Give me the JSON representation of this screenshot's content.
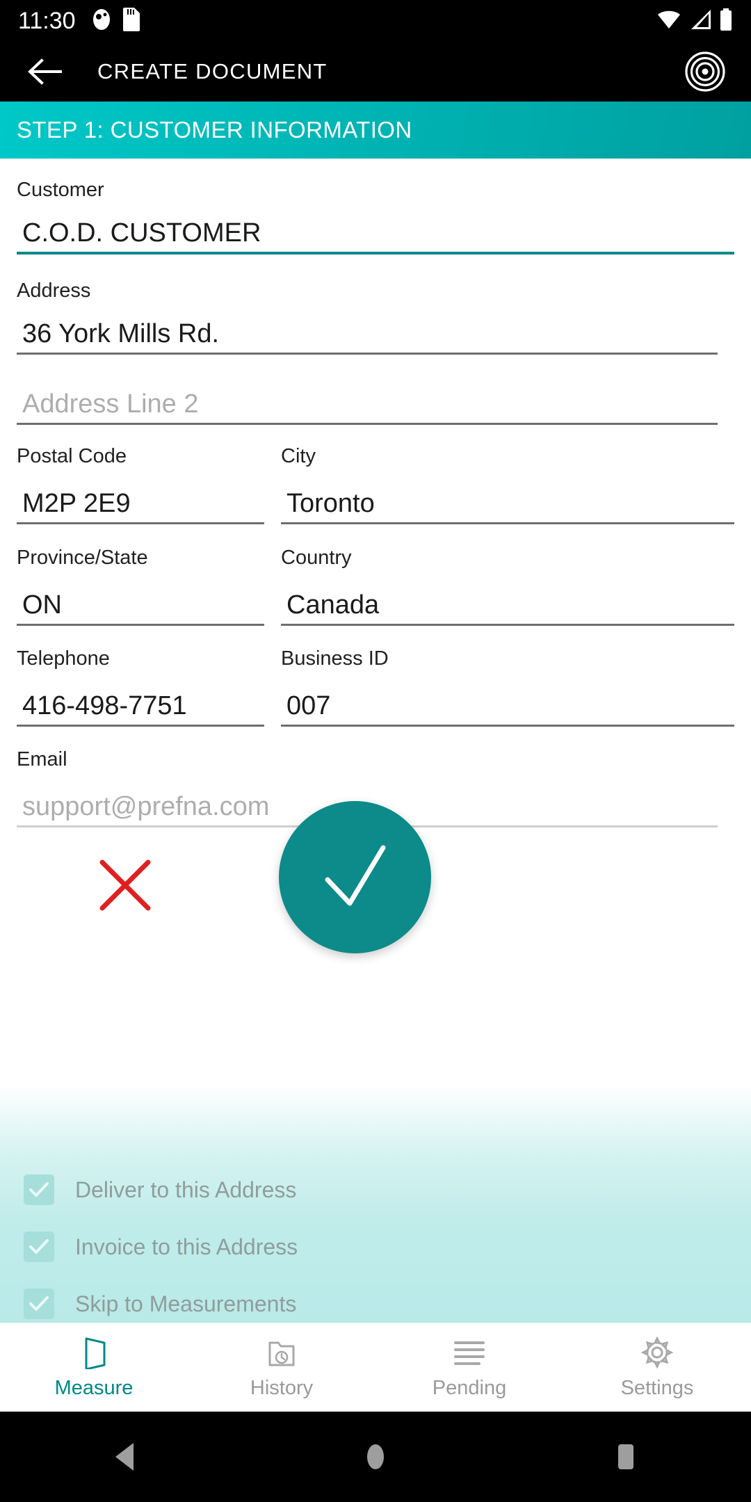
{
  "status_bar": {
    "time": "11:30",
    "left_icons": [
      "screen-record-icon",
      "sd-card-icon"
    ],
    "right_icons": [
      "wifi-icon",
      "cellular-signal-icon",
      "battery-icon"
    ]
  },
  "app_bar": {
    "back_icon": "back-arrow-icon",
    "title": "CREATE DOCUMENT",
    "action_icon": "bullseye-target-icon"
  },
  "step_banner": {
    "text": "STEP 1: CUSTOMER INFORMATION",
    "gradient_start": "#00c8c8",
    "gradient_end": "#00a0a0"
  },
  "form": {
    "fields": [
      {
        "label": "Customer",
        "value": "C.O.D. CUSTOMER",
        "placeholder": "",
        "focused": true,
        "is_placeholder": false
      },
      {
        "label": "Address",
        "value": "36 York Mills Rd.",
        "placeholder": "",
        "focused": false,
        "is_placeholder": false
      },
      {
        "label": "",
        "value": "Address Line 2",
        "placeholder": "Address Line 2",
        "focused": false,
        "is_placeholder": true
      },
      {
        "label": "Postal Code",
        "value": "M2P 2E9",
        "placeholder": "",
        "focused": false,
        "is_placeholder": false
      },
      {
        "label": "City",
        "value": "Toronto",
        "placeholder": "",
        "focused": false,
        "is_placeholder": false
      },
      {
        "label": "Province/State",
        "value": "ON",
        "placeholder": "",
        "focused": false,
        "is_placeholder": false
      },
      {
        "label": "Country",
        "value": "Canada",
        "placeholder": "",
        "focused": false,
        "is_placeholder": false
      },
      {
        "label": "Telephone",
        "value": "416-498-7751",
        "placeholder": "",
        "focused": false,
        "is_placeholder": false
      },
      {
        "label": "Business ID",
        "value": "007",
        "placeholder": "",
        "focused": false,
        "is_placeholder": false
      },
      {
        "label": "Email",
        "value": "support@prefna.com",
        "placeholder": "support@prefna.com",
        "focused": false,
        "is_placeholder": true
      }
    ]
  },
  "checkboxes": [
    {
      "label": "Deliver to this Address",
      "checked": true
    },
    {
      "label": "Invoice to this Address",
      "checked": true
    },
    {
      "label": "Skip to Measurements",
      "checked": true
    }
  ],
  "fab": {
    "icon": "checkmark-icon",
    "color": "#0d8a8a"
  },
  "annotation": {
    "icon": "red-x-mark",
    "color": "#e02020"
  },
  "bottom_nav": {
    "active_color": "#00888a",
    "inactive_color": "#9a9a9a",
    "items": [
      {
        "label": "Measure",
        "icon": "perspective-measure-icon",
        "active": true
      },
      {
        "label": "History",
        "icon": "folder-clock-icon",
        "active": false
      },
      {
        "label": "Pending",
        "icon": "list-lines-icon",
        "active": false
      },
      {
        "label": "Settings",
        "icon": "gear-icon",
        "active": false
      }
    ]
  },
  "system_nav": {
    "back": "triangle-back-icon",
    "home": "circle-home-icon",
    "recents": "square-recents-icon"
  }
}
